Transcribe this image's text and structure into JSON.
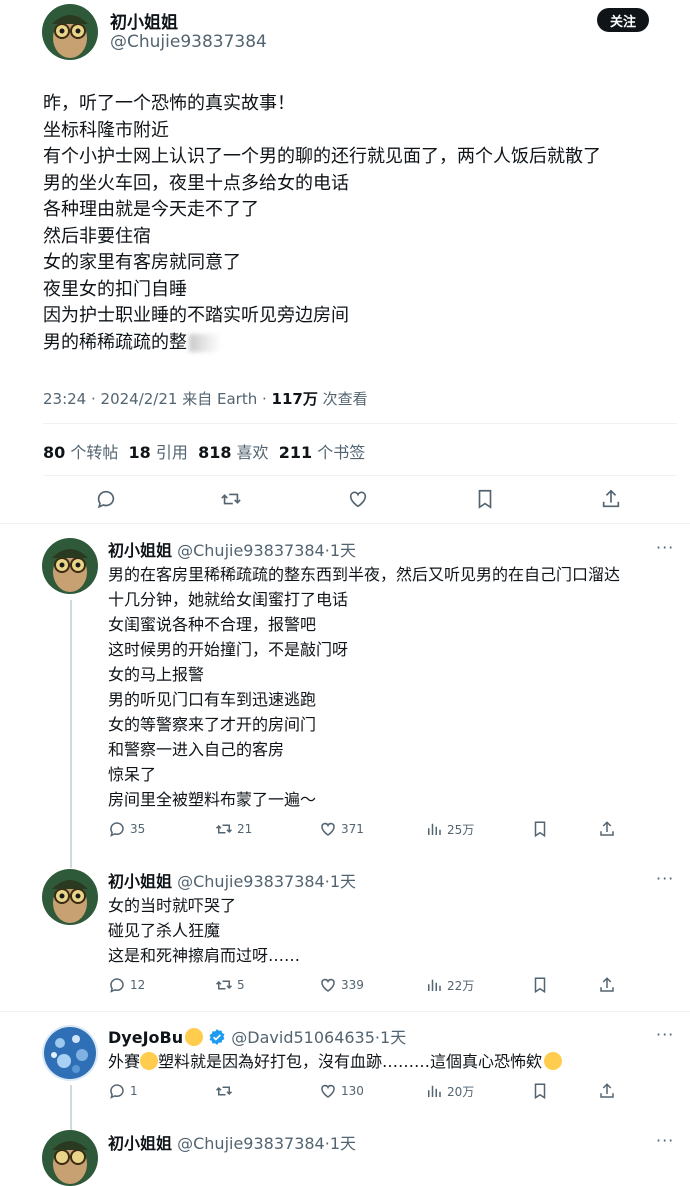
{
  "main_post": {
    "author_name": "初小姐姐",
    "author_handle": "@Chujie93837384",
    "follow_label": "关注",
    "lines": [
      "昨，听了一个恐怖的真实故事！",
      "坐标科隆市附近",
      "有个小护士网上认识了一个男的聊的还行就见面了，两个人饭后就散了",
      "男的坐火车回，夜里十点多给女的电话",
      "各种理由就是今天走不了了",
      "然后非要住宿",
      "女的家里有客房就同意了",
      "夜里女的扣门自睡",
      "因为护士职业睡的不踏实听见旁边房间",
      "男的稀稀疏疏的整"
    ],
    "meta": "23:24 · 2024/2/21 来自 Earth · ",
    "views_count": "117万",
    "views_label": " 次查看",
    "stats": [
      {
        "count": "80",
        "label": " 个转帖"
      },
      {
        "count": "18",
        "label": " 引用"
      },
      {
        "count": "818",
        "label": " 喜欢"
      },
      {
        "count": "211",
        "label": " 个书签"
      }
    ],
    "actions": [
      "reply",
      "retweet",
      "like",
      "bookmark",
      "share"
    ]
  },
  "replies": [
    {
      "author_name": "初小姐姐",
      "author_handle": "@Chujie93837384",
      "time": "·1天",
      "lines": [
        "男的在客房里稀稀疏疏的整东西到半夜，然后又听见男的在自己门口溜达",
        "十几分钟，她就给女闺蜜打了电话",
        "女闺蜜说各种不合理，报警吧",
        "这时候男的开始撞门，不是敲门呀",
        "女的马上报警",
        "男的听见门口有车到迅速逃跑",
        "女的等警察来了才开的房间门",
        "和警察一进入自己的客房",
        "惊呆了",
        "房间里全被塑料布蒙了一遍～"
      ],
      "replies_count": "35",
      "retweets_count": "21",
      "likes_count": "371",
      "views_count": "25万"
    },
    {
      "author_name": "初小姐姐",
      "author_handle": "@Chujie93837384",
      "time": "·1天",
      "lines": [
        "女的当时就吓哭了",
        "碰见了杀人狂魔",
        "这是和死神擦肩而过呀……"
      ],
      "replies_count": "12",
      "retweets_count": "5",
      "likes_count": "339",
      "views_count": "22万"
    },
    {
      "author_name": "DyeJoBu",
      "author_handle": "@David51064635",
      "time": "·1天",
      "line_parts": [
        "外賽",
        "塑料就是因為好打包，沒有血跡………這個真心恐怖欸"
      ],
      "replies_count": "1",
      "retweets_count": "",
      "likes_count": "130",
      "views_count": "20万"
    },
    {
      "author_name": "初小姐姐",
      "author_handle": "@Chujie93837384",
      "time": "·1天"
    }
  ],
  "more_label": "···",
  "colors": {
    "text": "#0f1419",
    "muted": "#536471",
    "divider": "#eff3f4",
    "verified": "#1d9bf0",
    "emoji": "#ffcc4d"
  }
}
